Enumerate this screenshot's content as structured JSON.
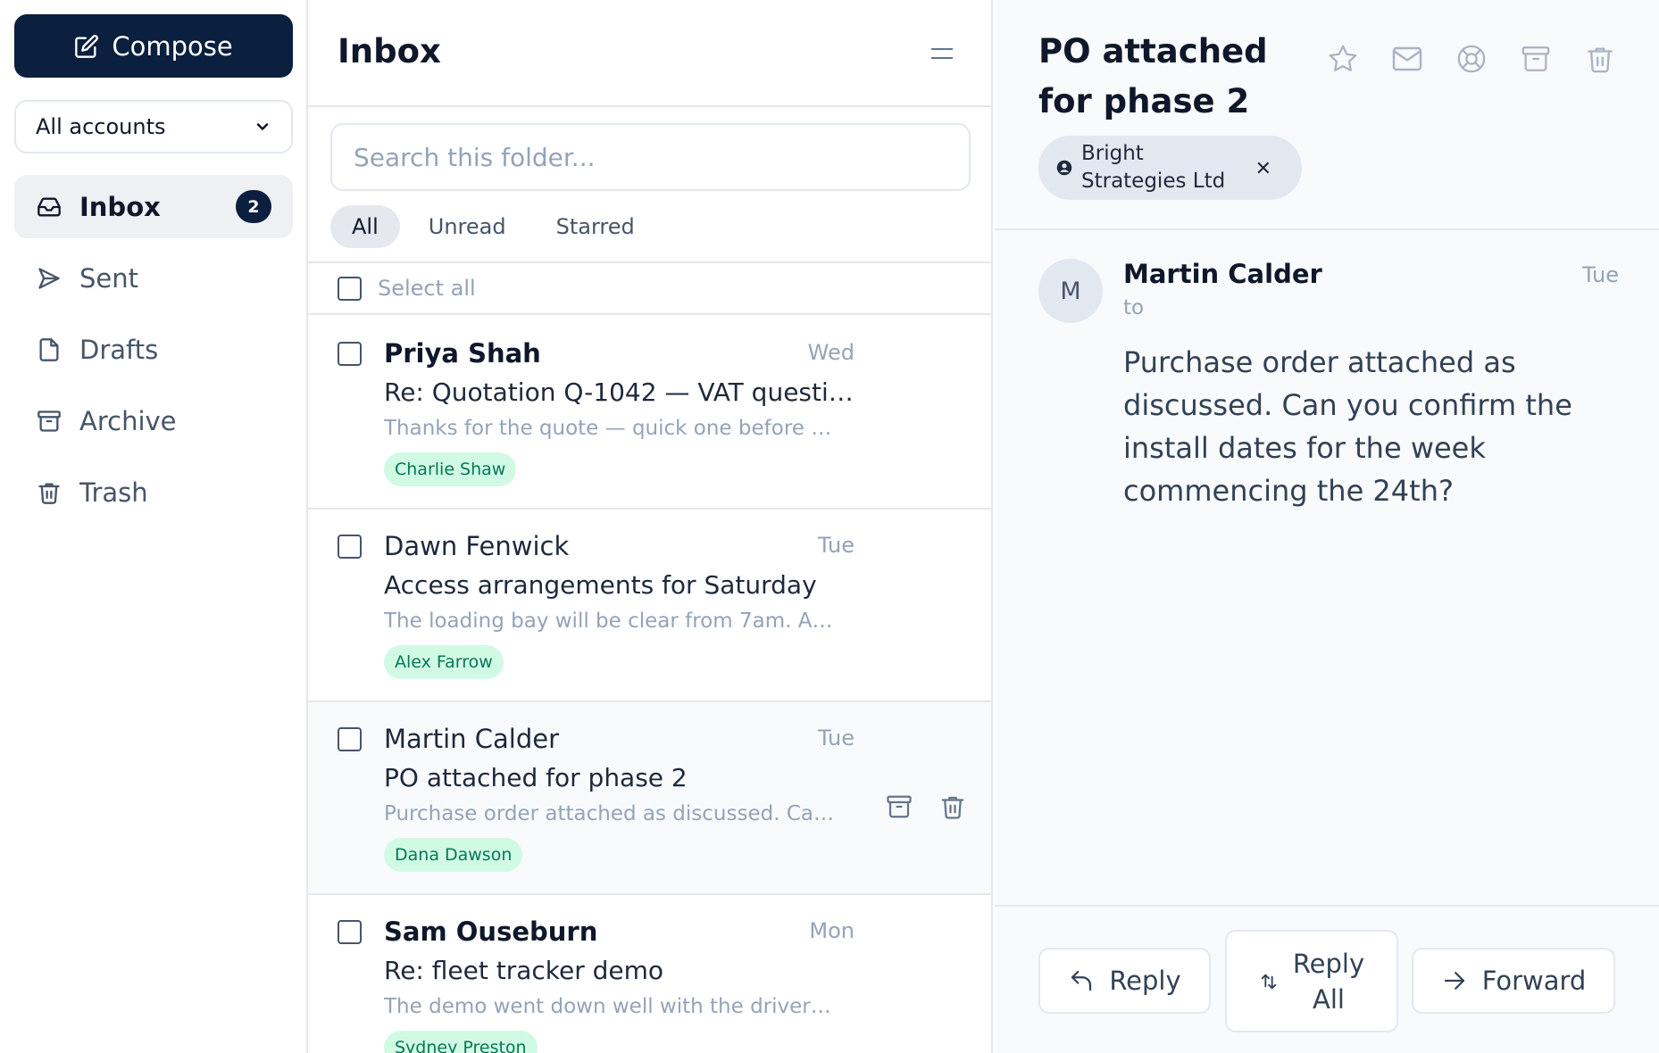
{
  "sidebar": {
    "compose_label": "Compose",
    "account_selected": "All accounts",
    "nav": [
      {
        "label": "Inbox",
        "icon": "inbox-icon",
        "badge": "2",
        "active": true
      },
      {
        "label": "Sent",
        "icon": "send-icon"
      },
      {
        "label": "Drafts",
        "icon": "file-icon"
      },
      {
        "label": "Archive",
        "icon": "archive-icon"
      },
      {
        "label": "Trash",
        "icon": "trash-icon"
      }
    ]
  },
  "list": {
    "title": "Inbox",
    "search_placeholder": "Search this folder...",
    "filters": [
      "All",
      "Unread",
      "Starred"
    ],
    "active_filter": "All",
    "select_all_label": "Select all",
    "messages": [
      {
        "sender": "Priya Shah",
        "date": "Wed",
        "subject": "Re: Quotation Q-1042 — VAT questi…",
        "preview": "Thanks for the quote — quick one before …",
        "tag": "Charlie Shaw",
        "unread": true
      },
      {
        "sender": "Dawn Fenwick",
        "date": "Tue",
        "subject": "Access arrangements for Saturday",
        "preview": "The loading bay will be clear from 7am. A…",
        "tag": "Alex Farrow",
        "unread": false
      },
      {
        "sender": "Martin Calder",
        "date": "Tue",
        "subject": "PO attached for phase 2",
        "preview": "Purchase order attached as discussed. Ca…",
        "tag": "Dana Dawson",
        "unread": false,
        "hovered": true
      },
      {
        "sender": "Sam Ouseburn",
        "date": "Mon",
        "subject": "Re: fleet tracker demo",
        "preview": "The demo went down well with the driver…",
        "tag": "Sydney Preston",
        "unread": true
      }
    ]
  },
  "reader": {
    "title": "PO attached for phase 2",
    "contact_chip": "Bright Strategies Ltd",
    "from_initial": "M",
    "from_name": "Martin Calder",
    "from_date": "Tue",
    "to_label": "to",
    "body": "Purchase order attached as discussed. Can you confirm the install dates for the week commencing the 24th?",
    "reply_label": "Reply",
    "reply_all_label_1": "Reply",
    "reply_all_label_2": "All",
    "forward_label": "Forward"
  },
  "colors": {
    "primary": "#0b1f3f",
    "tag_bg": "#d1fae5",
    "tag_text": "#047857",
    "muted": "#94a3b8"
  }
}
